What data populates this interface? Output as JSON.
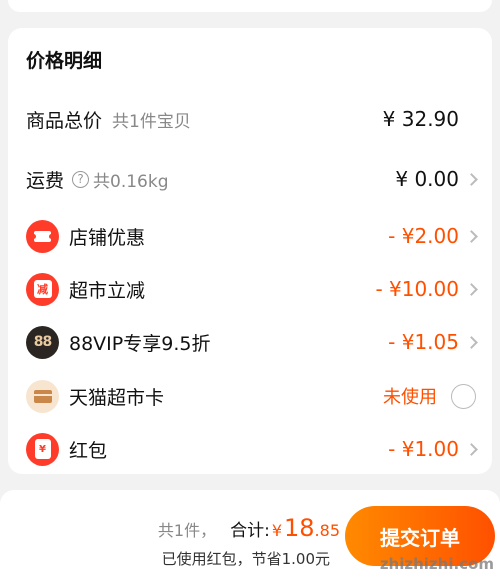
{
  "price_detail": {
    "title": "价格明细",
    "goods_total": {
      "label": "商品总价",
      "sub": "共1件宝贝",
      "amount": "¥ 32.90"
    },
    "shipping": {
      "label": "运费",
      "help_icon": "?",
      "sub": "共0.16kg",
      "amount": "¥ 0.00"
    },
    "discounts": [
      {
        "icon": "ticket-icon",
        "label": "店铺优惠",
        "amount": "- ¥2.00"
      },
      {
        "icon": "jian-icon",
        "icon_text": "减",
        "label": "超市立减",
        "amount": "- ¥10.00"
      },
      {
        "icon": "vip88-icon",
        "icon_text": "88",
        "label": "88VIP专享9.5折",
        "amount": "- ¥1.05"
      }
    ],
    "market_card": {
      "icon": "card-icon",
      "label": "天猫超市卡",
      "status": "未使用",
      "selected": false
    },
    "red_packet": {
      "icon": "envelope-icon",
      "icon_text": "¥",
      "label": "红包",
      "amount": "- ¥1.00"
    }
  },
  "bottom_bar": {
    "count": "共1件，",
    "total_label": "合计:",
    "currency": "¥",
    "total_int": "18",
    "total_dec": ".85",
    "savings": "已使用红包，节省1.00元",
    "submit_label": "提交订单"
  },
  "watermark": "zhizhizhi.com",
  "colors": {
    "accent": "#ff5000",
    "badge_red": "#ff3c29",
    "vip_dark": "#2b2622"
  }
}
